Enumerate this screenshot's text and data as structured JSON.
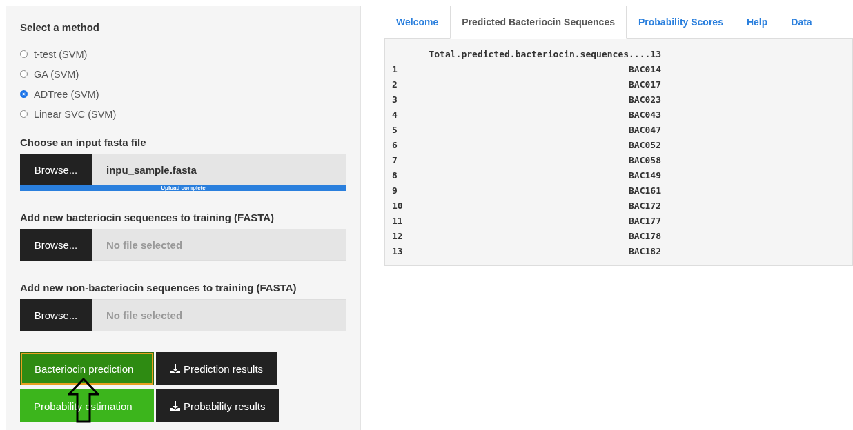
{
  "sidebar": {
    "method_label": "Select a method",
    "methods": [
      {
        "label": "t-test (SVM)",
        "selected": false
      },
      {
        "label": "GA (SVM)",
        "selected": false
      },
      {
        "label": "ADTree (SVM)",
        "selected": true
      },
      {
        "label": "Linear SVC (SVM)",
        "selected": false
      }
    ],
    "file_inputs": [
      {
        "label": "Choose an input fasta file",
        "button": "Browse...",
        "value": "inpu_sample.fasta",
        "progress": {
          "level": 1,
          "text": "Upload complete"
        }
      },
      {
        "label": "Add new bacteriocin sequences to training (FASTA)",
        "button": "Browse...",
        "placeholder": "No file selected"
      },
      {
        "label": "Add new non-bacteriocin sequences to training (FASTA)",
        "button": "Browse...",
        "placeholder": "No file selected"
      }
    ],
    "button_rows": [
      [
        {
          "label": "Bacteriocin prediction",
          "kind": "primary",
          "focused": true
        },
        {
          "label": "Prediction results",
          "kind": "download",
          "focused": false
        }
      ],
      [
        {
          "label": "Probability estimation",
          "kind": "success",
          "focused": false
        },
        {
          "label": "Probability results",
          "kind": "download",
          "focused": false
        }
      ]
    ]
  },
  "tabs": [
    {
      "label": "Welcome",
      "selected": false
    },
    {
      "label": "Predicted Bacteriocin Sequences",
      "selected": true
    },
    {
      "label": "Probability Scores",
      "selected": false
    },
    {
      "label": "Help",
      "selected": false
    },
    {
      "label": "Data",
      "selected": false
    }
  ],
  "output": {
    "header": "Total.predicted.bacteriocin.sequences....13",
    "rows": [
      {
        "index": "1",
        "value": "BAC014"
      },
      {
        "index": "2",
        "value": "BAC017"
      },
      {
        "index": "3",
        "value": "BAC023"
      },
      {
        "index": "4",
        "value": "BAC043"
      },
      {
        "index": "5",
        "value": "BAC047"
      },
      {
        "index": "6",
        "value": "BAC052"
      },
      {
        "index": "7",
        "value": "BAC058"
      },
      {
        "index": "8",
        "value": "BAC149"
      },
      {
        "index": "9",
        "value": "BAC161"
      },
      {
        "index": "10",
        "value": "BAC172"
      },
      {
        "index": "11",
        "value": "BAC177"
      },
      {
        "index": "12",
        "value": "BAC178"
      },
      {
        "index": "13",
        "value": "BAC182"
      }
    ]
  }
}
